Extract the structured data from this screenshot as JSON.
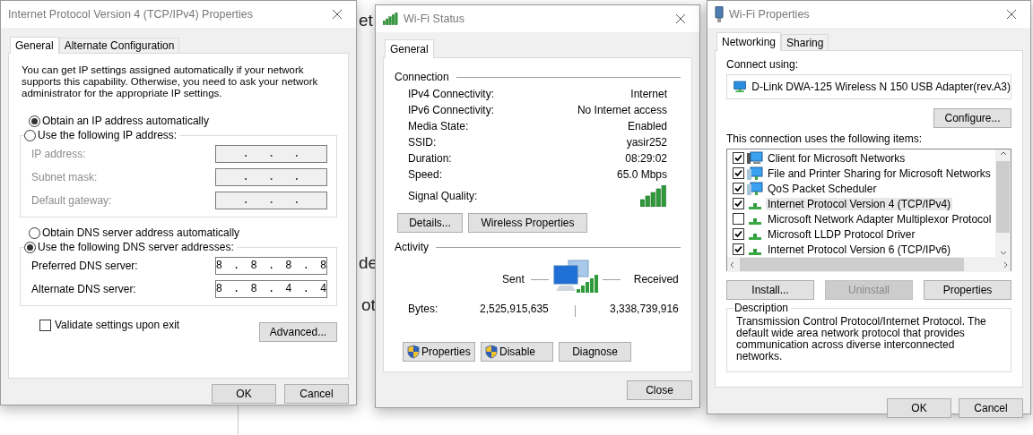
{
  "background_window": {
    "fragments": [
      "et",
      "de",
      "ot"
    ]
  },
  "ipv4_dialog": {
    "title": "Internet Protocol Version 4 (TCP/IPv4) Properties",
    "tabs": [
      {
        "label": "General",
        "selected": true
      },
      {
        "label": "Alternate Configuration",
        "selected": false
      }
    ],
    "intro": "You can get IP settings assigned automatically if your network supports this capability. Otherwise, you need to ask your network administrator for the appropriate IP settings.",
    "ip_options": [
      {
        "label": "Obtain an IP address automatically",
        "selected": true
      },
      {
        "label": "Use the following IP address:",
        "selected": false
      }
    ],
    "ip_fields": [
      {
        "label": "IP address:",
        "value": ". . .",
        "disabled": true
      },
      {
        "label": "Subnet mask:",
        "value": ". . .",
        "disabled": true
      },
      {
        "label": "Default gateway:",
        "value": ". . .",
        "disabled": true
      }
    ],
    "dns_options": [
      {
        "label": "Obtain DNS server address automatically",
        "selected": false
      },
      {
        "label": "Use the following DNS server addresses:",
        "selected": true
      }
    ],
    "dns_fields": [
      {
        "label": "Preferred DNS server:",
        "value": "8 . 8 . 8 . 8",
        "disabled": false
      },
      {
        "label": "Alternate DNS server:",
        "value": "8 . 8 . 4 . 4",
        "disabled": false
      }
    ],
    "validate": {
      "label": "Validate settings upon exit",
      "checked": false
    },
    "advanced_button": "Advanced...",
    "buttons": [
      "OK",
      "Cancel"
    ]
  },
  "wifi_status": {
    "title": "Wi-Fi Status",
    "tabs": [
      {
        "label": "General",
        "selected": true
      }
    ],
    "connection_title": "Connection",
    "rows": [
      {
        "label": "IPv4 Connectivity:",
        "value": "Internet"
      },
      {
        "label": "IPv6 Connectivity:",
        "value": "No Internet access"
      },
      {
        "label": "Media State:",
        "value": "Enabled"
      },
      {
        "label": "SSID:",
        "value": "yasir252"
      },
      {
        "label": "Duration:",
        "value": "08:29:02"
      },
      {
        "label": "Speed:",
        "value": "65.0 Mbps"
      }
    ],
    "signal_label": "Signal Quality:",
    "connection_buttons": [
      "Details...",
      "Wireless Properties"
    ],
    "activity_title": "Activity",
    "sent_label": "Sent",
    "received_label": "Received",
    "bytes_label": "Bytes:",
    "bytes_sent": "2,525,915,635",
    "bytes_received": "3,338,739,916",
    "action_buttons": [
      {
        "label": "Properties",
        "shield": true
      },
      {
        "label": "Disable",
        "shield": true
      },
      {
        "label": "Diagnose",
        "shield": false
      }
    ],
    "close_button": "Close"
  },
  "wifi_properties": {
    "title": "Wi-Fi Properties",
    "tabs": [
      {
        "label": "Networking",
        "selected": true
      },
      {
        "label": "Sharing",
        "selected": false
      }
    ],
    "connect_using_label": "Connect using:",
    "adapter": "D-Link DWA-125 Wireless N 150 USB Adapter(rev.A3)",
    "configure_button": "Configure...",
    "items_label": "This connection uses the following items:",
    "items": [
      {
        "label": "Client for Microsoft Networks",
        "checked": true,
        "selected": false,
        "kind": "client"
      },
      {
        "label": "File and Printer Sharing for Microsoft Networks",
        "checked": true,
        "selected": false,
        "kind": "service"
      },
      {
        "label": "QoS Packet Scheduler",
        "checked": true,
        "selected": false,
        "kind": "service"
      },
      {
        "label": "Internet Protocol Version 4 (TCP/IPv4)",
        "checked": true,
        "selected": true,
        "kind": "protocol"
      },
      {
        "label": "Microsoft Network Adapter Multiplexor Protocol",
        "checked": false,
        "selected": false,
        "kind": "protocol"
      },
      {
        "label": "Microsoft LLDP Protocol Driver",
        "checked": true,
        "selected": false,
        "kind": "protocol"
      },
      {
        "label": "Internet Protocol Version 6 (TCP/IPv6)",
        "checked": true,
        "selected": false,
        "kind": "protocol"
      }
    ],
    "item_buttons": [
      {
        "label": "Install...",
        "disabled": false
      },
      {
        "label": "Uninstall",
        "disabled": true
      },
      {
        "label": "Properties",
        "disabled": false
      }
    ],
    "description_title": "Description",
    "description": "Transmission Control Protocol/Internet Protocol. The default wide area network protocol that provides communication across diverse interconnected networks.",
    "buttons": [
      "OK",
      "Cancel"
    ]
  }
}
